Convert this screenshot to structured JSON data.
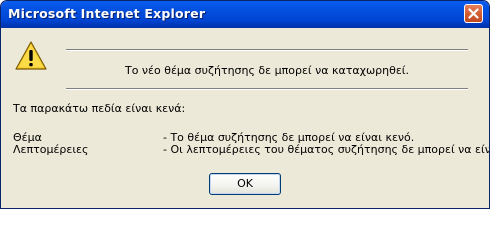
{
  "dialog": {
    "title": "Microsoft Internet Explorer",
    "message": "Το νέο θέμα συζήτησης δε μπορεί να καταχωρηθεί.",
    "intro": "Τα παρακάτω πεδία είναι κενά:",
    "fields": [
      {
        "name": "Θέμα",
        "description": "- Το θέμα συζήτησης δε μπορεί να είναι κενό."
      },
      {
        "name": "Λεπτομέρειες",
        "description": "- Οι λεπτομέρειες του θέματος συζήτησης δε μπορεί να είναι κενές."
      }
    ],
    "ok_label": "OK"
  },
  "icons": {
    "close": "close-icon",
    "warning": "warning-icon"
  },
  "colors": {
    "titlebar": "#0054e3",
    "close_button": "#d35a2f",
    "background": "#ece9d8",
    "warning_yellow": "#f8d030"
  }
}
